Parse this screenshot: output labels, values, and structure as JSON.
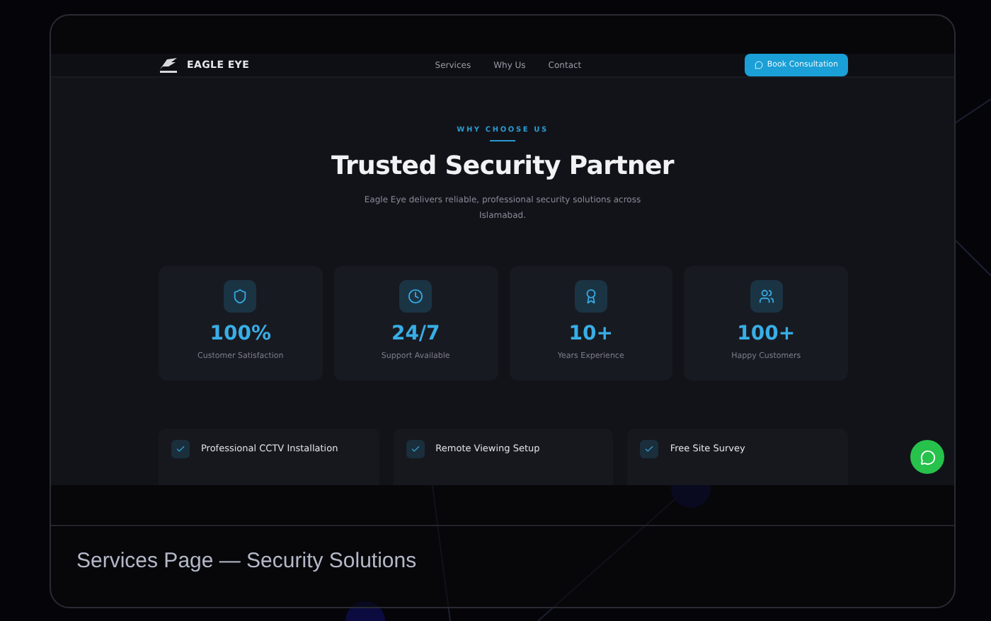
{
  "brand": {
    "name": "EAGLE EYE"
  },
  "nav": [
    {
      "label": "Services"
    },
    {
      "label": "Why Us"
    },
    {
      "label": "Contact"
    }
  ],
  "cta": {
    "label": "Book Consultation"
  },
  "hero": {
    "eyebrow": "WHY CHOOSE US",
    "title": "Trusted Security Partner",
    "description": "Eagle Eye delivers reliable, professional security solutions across Islamabad."
  },
  "stats": [
    {
      "kind": "shield",
      "value": "100%",
      "label": "Customer Satisfaction"
    },
    {
      "kind": "clock",
      "value": "24/7",
      "label": "Support Available"
    },
    {
      "kind": "award",
      "value": "10+",
      "label": "Years Experience"
    },
    {
      "kind": "users",
      "value": "100+",
      "label": "Happy Customers"
    }
  ],
  "features": [
    {
      "label": "Professional CCTV Installation"
    },
    {
      "label": "Remote Viewing Setup"
    },
    {
      "label": "Free Site Survey"
    }
  ],
  "caption": "Services Page — Security Solutions"
}
